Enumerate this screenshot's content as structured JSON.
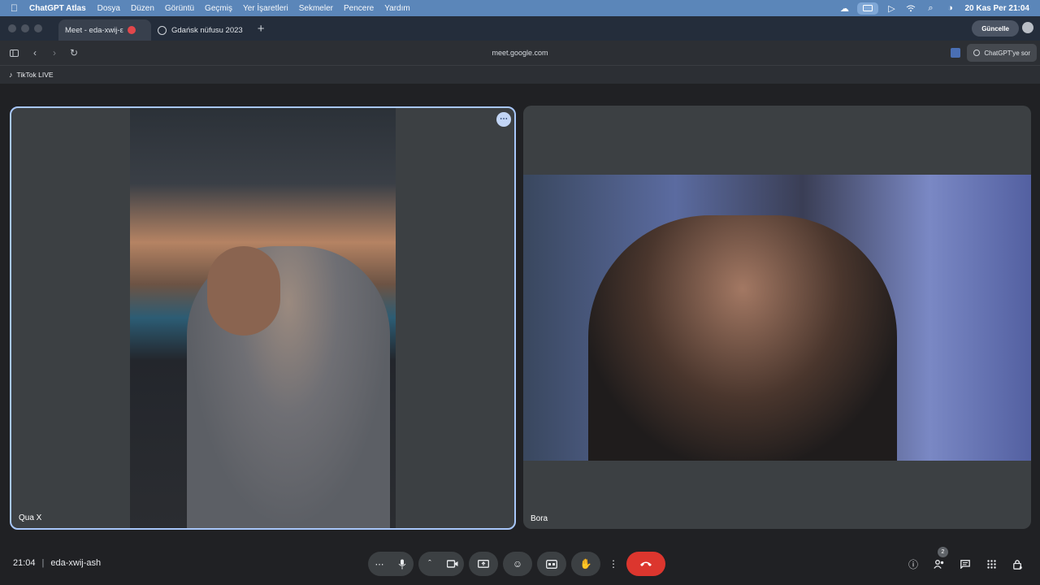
{
  "menubar": {
    "app_name": "ChatGPT Atlas",
    "items": [
      "Dosya",
      "Düzen",
      "Görüntü",
      "Geçmiş",
      "Yer İşaretleri",
      "Sekmeler",
      "Pencere",
      "Yardım"
    ],
    "clock": "20 Kas Per  21:04"
  },
  "tabs": [
    {
      "label": "Meet - eda-xwij-ε",
      "active": true
    },
    {
      "label": "Gdańsk nüfusu 2023",
      "active": false
    }
  ],
  "tabstrip": {
    "update_label": "Güncelle",
    "new_tab": "+"
  },
  "toolbar": {
    "url": "meet.google.com",
    "ask_label": "ChatGPT'ye sor"
  },
  "bookmarks": [
    {
      "label": "TikTok LIVE",
      "icon": "tiktok-icon"
    }
  ],
  "participants": [
    {
      "name": "Qua X",
      "pinned": true
    },
    {
      "name": "Bora",
      "pinned": false
    }
  ],
  "meeting": {
    "time": "21:04",
    "code": "eda-xwij-ash",
    "participant_count": "2"
  },
  "colors": {
    "accent": "#a8c7fa",
    "leave": "#dc362e",
    "menubar": "#5b86b9"
  }
}
